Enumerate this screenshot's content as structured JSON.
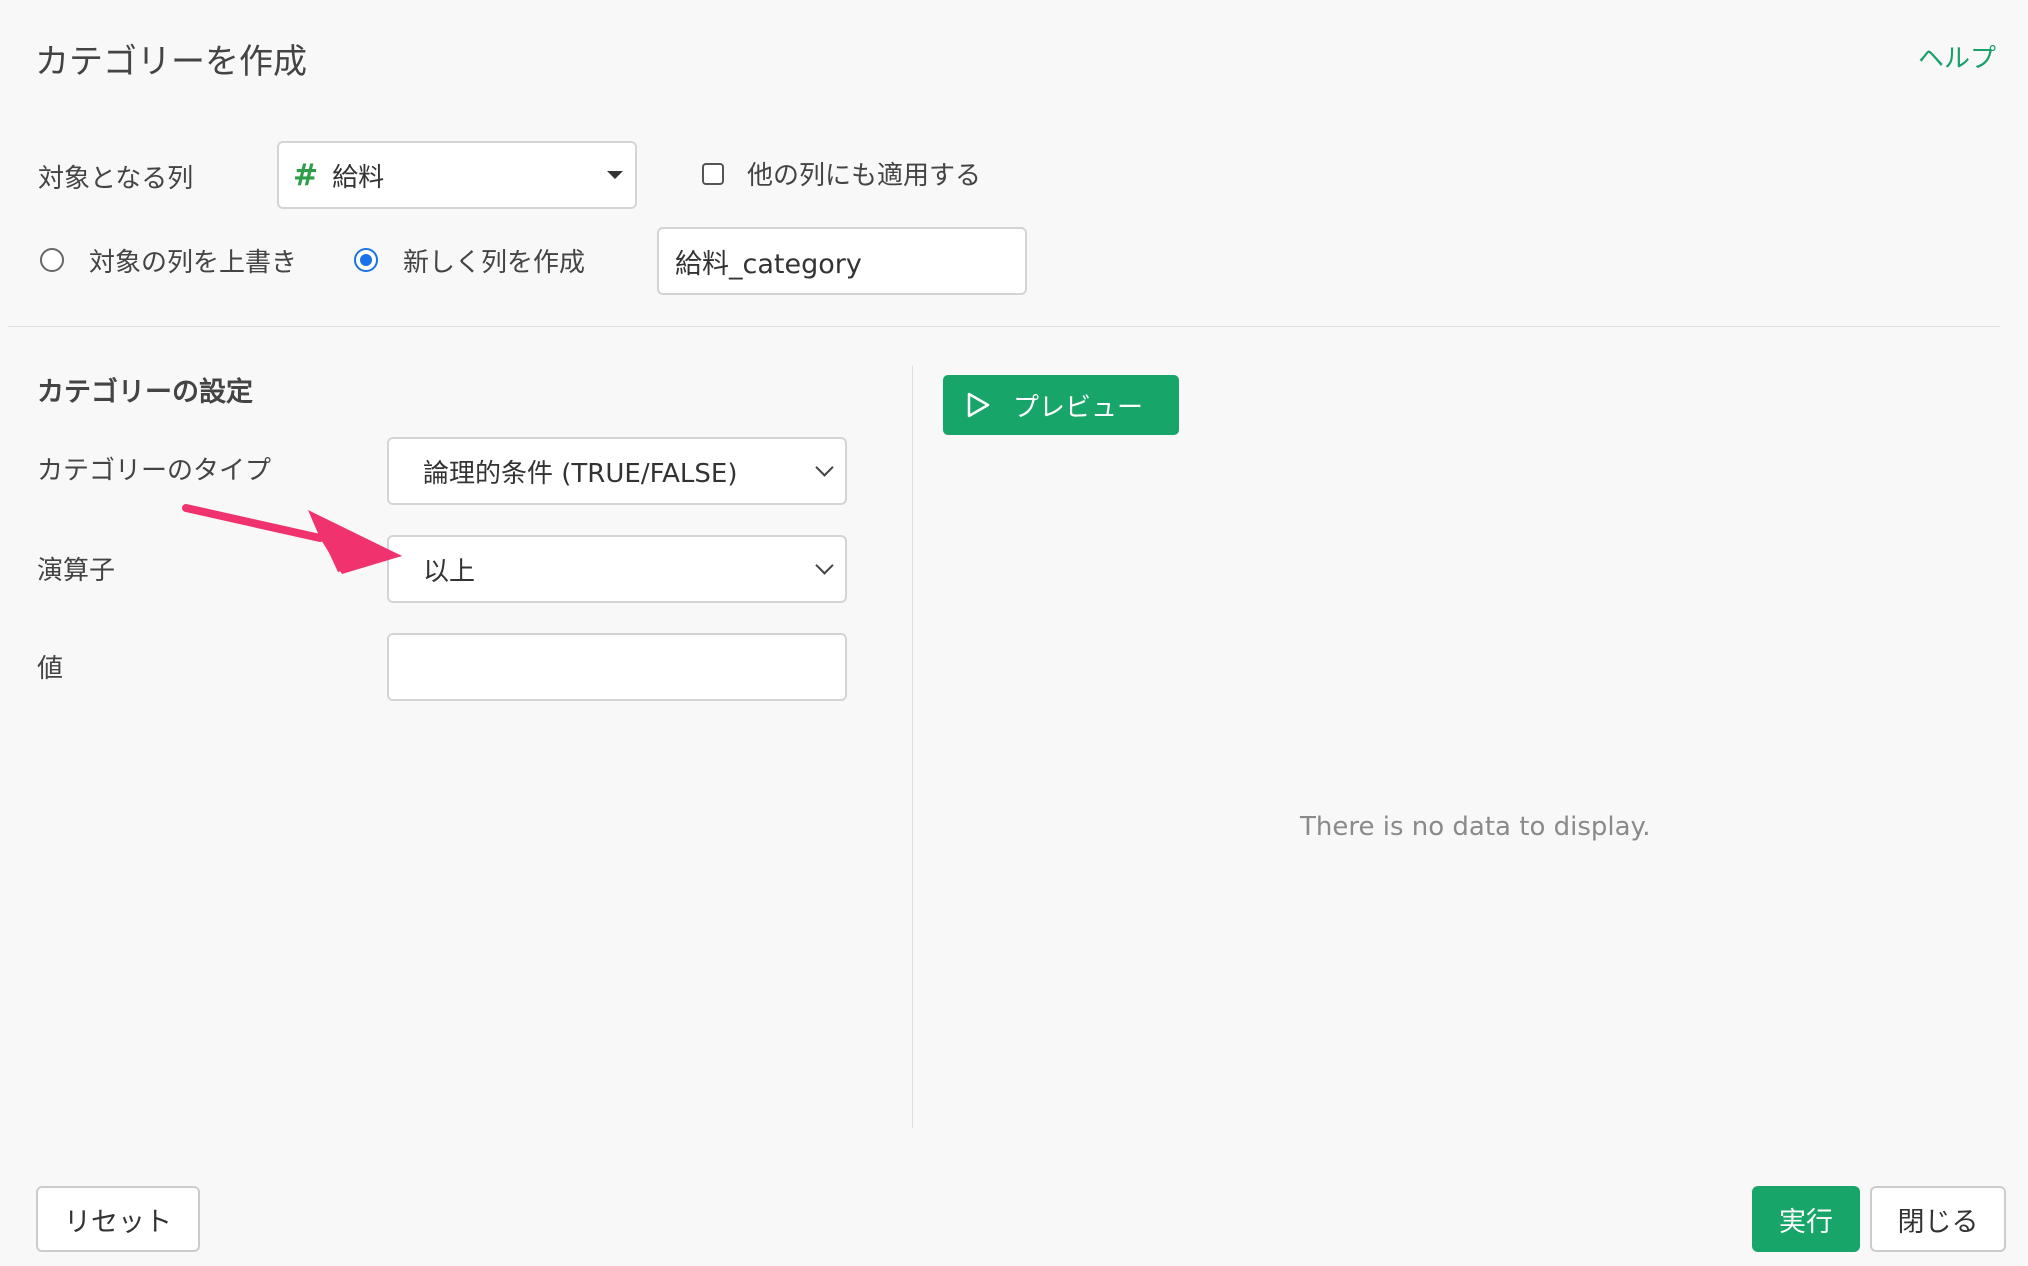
{
  "header": {
    "title": "カテゴリーを作成",
    "help_link": "ヘルプ"
  },
  "target": {
    "label": "対象となる列",
    "column_icon": "#",
    "column_value": "給料",
    "apply_others_label": "他の列にも適用する",
    "apply_others_checked": false
  },
  "output": {
    "overwrite_label": "対象の列を上書き",
    "new_column_label": "新しく列を作成",
    "selected": "new_column",
    "new_column_name": "給料_category"
  },
  "settings": {
    "section_title": "カテゴリーの設定",
    "type_label": "カテゴリーのタイプ",
    "type_value": "論理的条件 (TRUE/FALSE)",
    "operator_label": "演算子",
    "operator_value": "以上",
    "value_label": "値",
    "value_input": ""
  },
  "preview": {
    "button_label": "プレビュー",
    "empty_message": "There is no data to display."
  },
  "footer": {
    "reset_label": "リセット",
    "run_label": "実行",
    "close_label": "閉じる"
  },
  "colors": {
    "accent": "#17a56a",
    "annotation_arrow": "#f0326e",
    "radio_blue": "#1a73e8"
  }
}
